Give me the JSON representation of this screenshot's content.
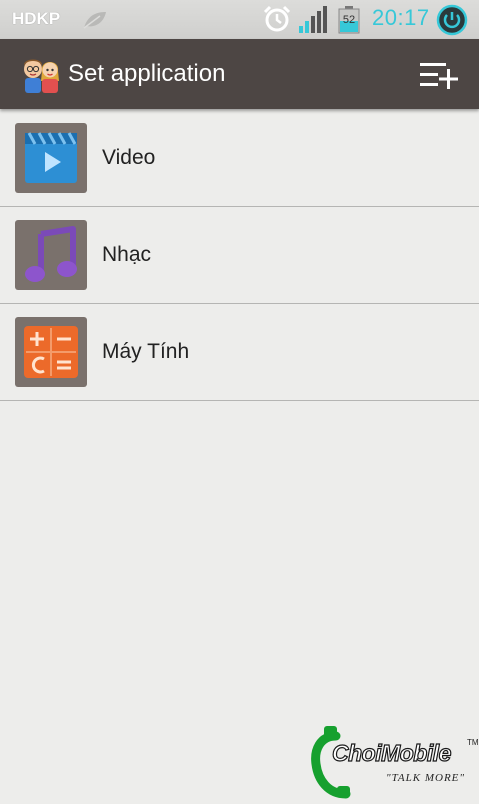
{
  "status_bar": {
    "carrier": "HDKP",
    "battery_level": "52",
    "time": "20:17"
  },
  "action_bar": {
    "title": "Set application",
    "action_icon": "add-list-icon"
  },
  "apps": [
    {
      "label": "Video",
      "icon": "video-icon"
    },
    {
      "label": "Nhạc",
      "icon": "music-icon"
    },
    {
      "label": "Máy Tính",
      "icon": "calculator-icon"
    }
  ],
  "watermark": {
    "brand": "ChoiMobile",
    "tagline": "\"TALK MORE\"",
    "tm": "TM"
  },
  "colors": {
    "clock": "#36c8d8",
    "action_bar": "#4d4644",
    "background": "#ededeb",
    "video_icon": "#2d8fd4",
    "music_icon": "#7b4ab8",
    "calculator_icon": "#ec6a2a"
  }
}
